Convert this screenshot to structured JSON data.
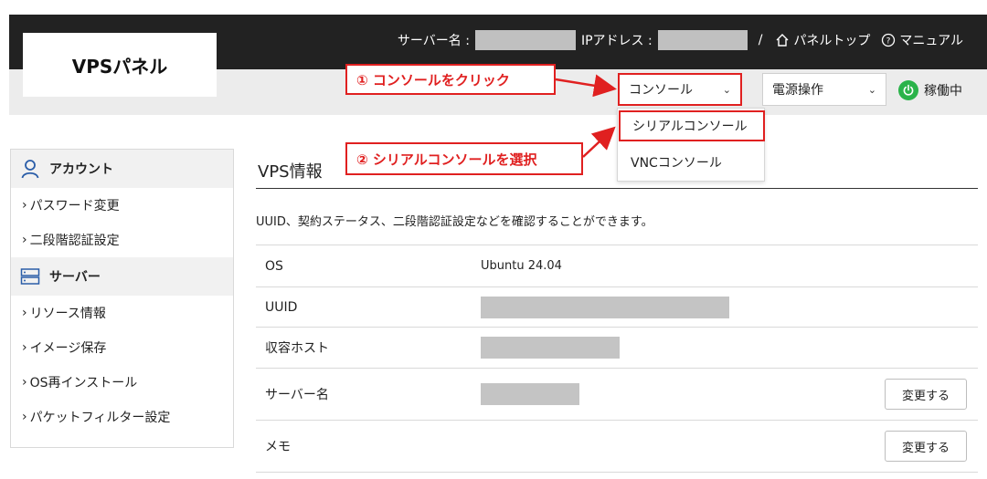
{
  "header": {
    "logo": "VPSパネル",
    "server_name_label": "サーバー名 :",
    "ip_label": "IPアドレス :",
    "separator": "/",
    "panel_top": "パネルトップ",
    "manual": "マニュアル"
  },
  "toolbar": {
    "console_select": "コンソール",
    "power_select": "電源操作",
    "status": "稼働中"
  },
  "dropdown": {
    "items": [
      "シリアルコンソール",
      "VNCコンソール"
    ]
  },
  "callouts": {
    "step1": "① コンソールをクリック",
    "step2": "② シリアルコンソールを選択"
  },
  "sidebar": {
    "account_heading": "アカウント",
    "account_items": [
      "パスワード変更",
      "二段階認証設定"
    ],
    "server_heading": "サーバー",
    "server_items": [
      "リソース情報",
      "イメージ保存",
      "OS再インストール",
      "パケットフィルター設定"
    ]
  },
  "main": {
    "title": "VPS情報",
    "description": "UUID、契約ステータス、二段階認証設定などを確認することができます。",
    "rows": [
      {
        "label": "OS",
        "value": "Ubuntu 24.04"
      },
      {
        "label": "UUID",
        "value": ""
      },
      {
        "label": "収容ホスト",
        "value": ""
      },
      {
        "label": "サーバー名",
        "value": "",
        "button": "変更する"
      },
      {
        "label": "メモ",
        "value": "",
        "button": "変更する"
      }
    ]
  },
  "colors": {
    "accent_red": "#e02020",
    "status_green": "#2bb34a",
    "header_bg": "#222222"
  }
}
